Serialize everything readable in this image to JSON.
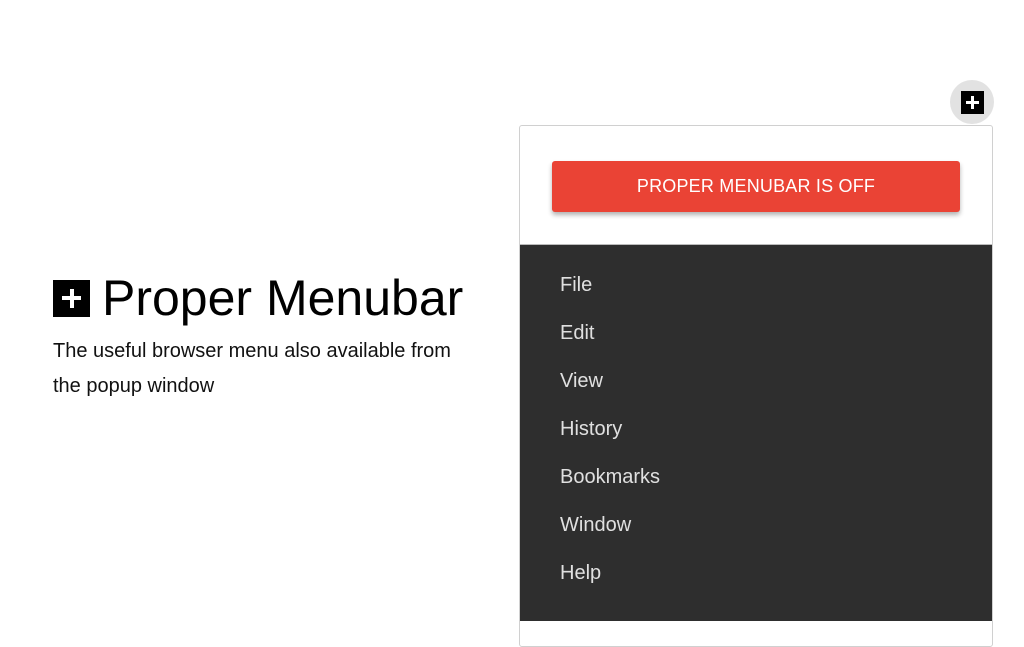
{
  "hero": {
    "title": "Proper Menubar",
    "description": "The useful browser menu also available from the popup window"
  },
  "fab": {
    "icon": "plus-icon"
  },
  "popup": {
    "toggle_label": "PROPER MENUBAR IS OFF",
    "toggle_color": "#ea4335",
    "menu_items": [
      {
        "label": "File"
      },
      {
        "label": "Edit"
      },
      {
        "label": "View"
      },
      {
        "label": "History"
      },
      {
        "label": "Bookmarks"
      },
      {
        "label": "Window"
      },
      {
        "label": "Help"
      }
    ]
  }
}
